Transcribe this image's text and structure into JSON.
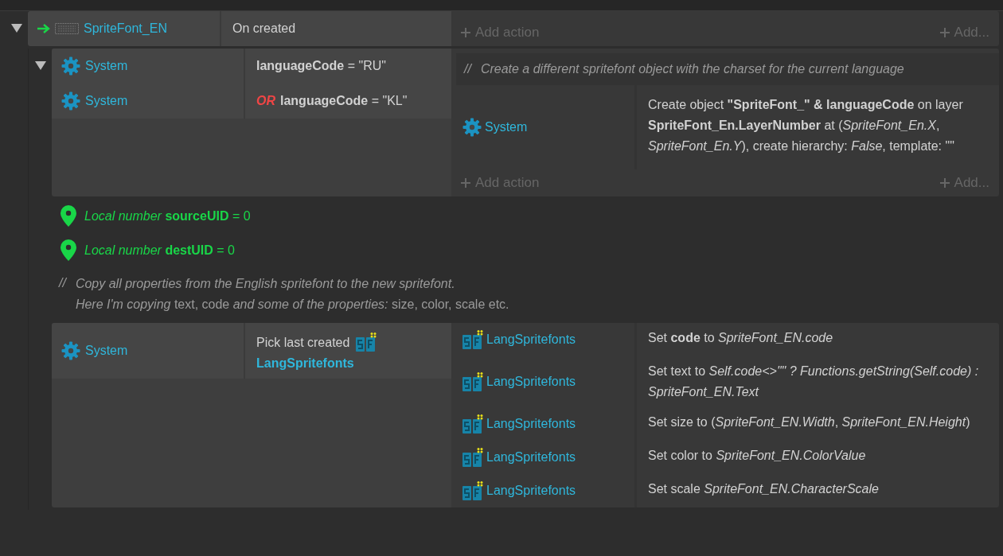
{
  "events": [
    {
      "kind": "event",
      "expanded": true,
      "conditions": [
        {
          "object": "SpriteFont_EN",
          "kind": "sprite",
          "trigger": true,
          "text": "On created"
        }
      ],
      "add_action": "Add action",
      "add_more": "Add...",
      "children": [
        {
          "kind": "event",
          "expanded": true,
          "conditions": [
            {
              "object": "System",
              "kind": "system",
              "text": "**languageCode** = \"RU\""
            },
            {
              "object": "System",
              "kind": "system",
              "or_label": "OR",
              "text": "**languageCode** = \"KL\""
            }
          ],
          "comment": "Create a different spritefont object with the charset for the current language",
          "comment_marker": "//",
          "actions": [
            {
              "object": "System",
              "kind": "system",
              "text": "Create object **\"SpriteFont_\" & languageCode** on layer **SpriteFont_En.LayerNumber** at (*SpriteFont_En.X*, *SpriteFont_En.Y*), create hierarchy: *False*, template: \"\""
            }
          ],
          "add_action": "Add action",
          "add_more": "Add..."
        },
        {
          "kind": "variable",
          "text": "*Local number* **sourceUID** = 0"
        },
        {
          "kind": "variable",
          "text": "*Local number* **destUID** = 0"
        },
        {
          "kind": "comment",
          "marker": "//",
          "lines": [
            "*Copy all properties from the English spritefont to the new spritefont.*",
            "*Here I'm copying* text, code *and some of the properties:* size, color, scale etc."
          ]
        },
        {
          "kind": "event",
          "conditions": [
            {
              "object": "System",
              "kind": "system",
              "text": "Pick last created",
              "param_object": "LangSpritefonts"
            }
          ],
          "actions": [
            {
              "object": "LangSpritefonts",
              "kind": "spritefont",
              "text": "Set **code** to *SpriteFont_EN.code*"
            },
            {
              "object": "LangSpritefonts",
              "kind": "spritefont",
              "text": "Set text to *Self.code<>\"\" ? Functions.getString(Self.code) : SpriteFont_EN.Text*"
            },
            {
              "object": "LangSpritefonts",
              "kind": "spritefont",
              "text": "Set size to (*SpriteFont_EN.Width*, *SpriteFont_EN.Height*)"
            },
            {
              "object": "LangSpritefonts",
              "kind": "spritefont",
              "text": "Set color to *SpriteFont_EN.ColorValue*"
            },
            {
              "object": "LangSpritefonts",
              "kind": "spritefont",
              "text": "Set scale *SpriteFont_EN.CharacterScale*"
            }
          ]
        }
      ]
    }
  ]
}
